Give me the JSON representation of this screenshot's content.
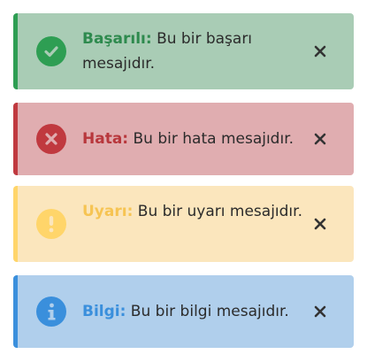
{
  "alerts": [
    {
      "type": "success",
      "title": "Başarılı:",
      "message": " Bu bir başarı mesajıdır.",
      "icon": "check-circle-icon",
      "color": "#2e9e53"
    },
    {
      "type": "error",
      "title": "Hata:",
      "message": " Bu bir hata mesajıdır.",
      "icon": "x-circle-icon",
      "color": "#c0393f"
    },
    {
      "type": "warning",
      "title": "Uyarı:",
      "message": " Bu bir uyarı mesajıdır.",
      "icon": "exclamation-circle-icon",
      "color": "#ffd56a"
    },
    {
      "type": "info",
      "title": "Bilgi:",
      "message": " Bu bir bilgi mesajıdır.",
      "icon": "info-circle-icon",
      "color": "#3a8fdc"
    }
  ],
  "close_icon": "close-icon"
}
